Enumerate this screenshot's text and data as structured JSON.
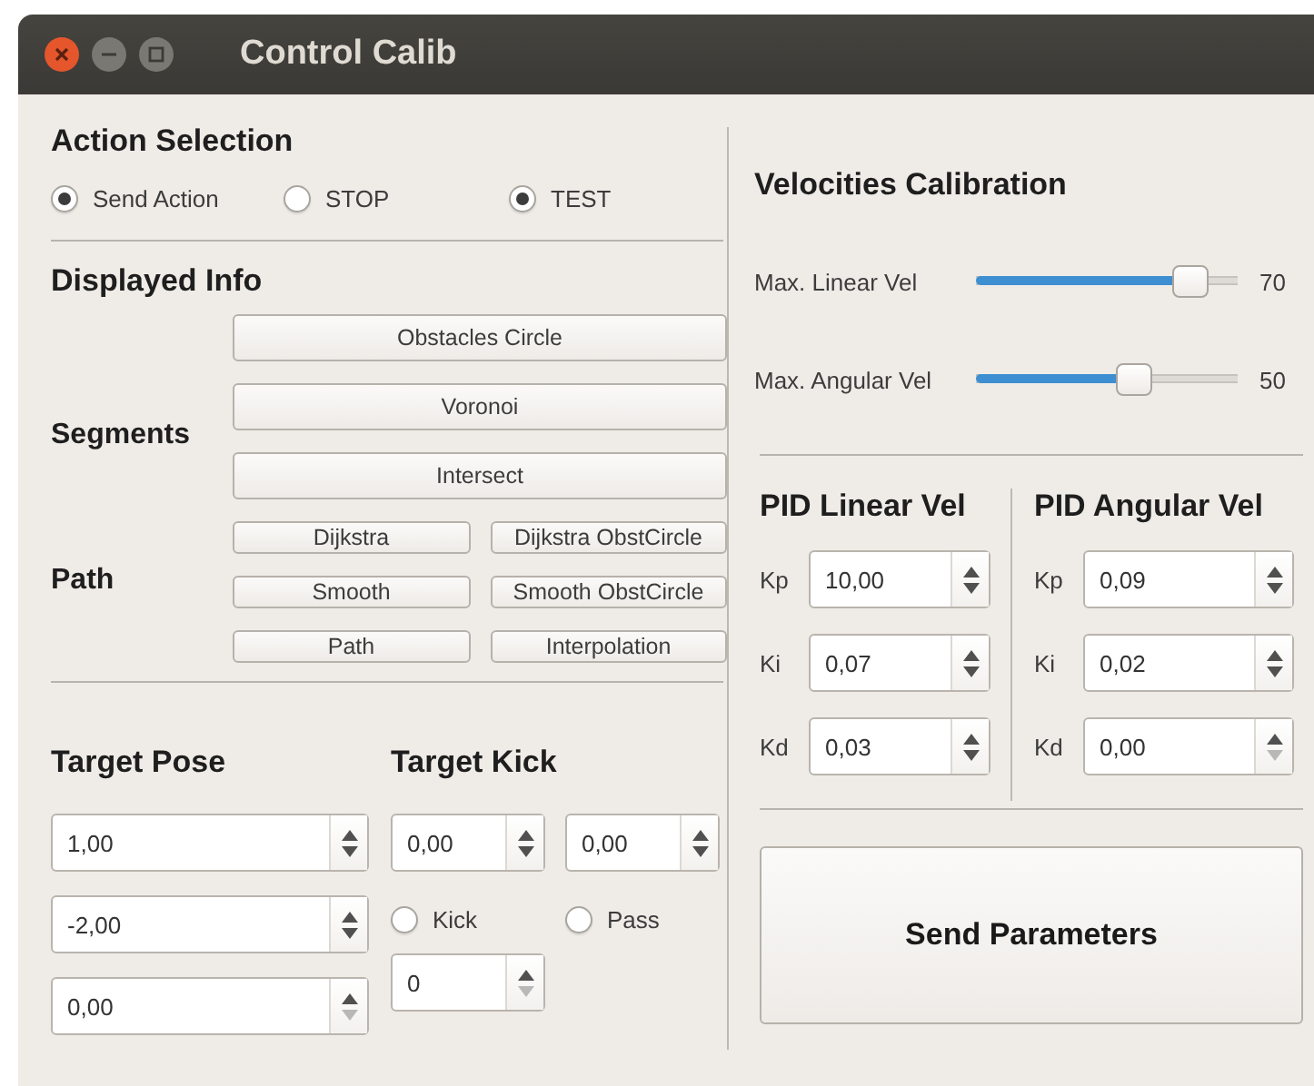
{
  "window": {
    "title": "Control Calib"
  },
  "action_selection": {
    "title": "Action Selection",
    "options": [
      {
        "label": "Send Action",
        "selected": true
      },
      {
        "label": "STOP",
        "selected": false
      },
      {
        "label": "TEST",
        "selected": true
      }
    ]
  },
  "displayed_info": {
    "title": "Displayed Info",
    "groups": [
      {
        "label": "Segments",
        "rows": [
          [
            "Obstacles Circle"
          ],
          [
            "Voronoi"
          ],
          [
            "Intersect"
          ]
        ]
      },
      {
        "label": "Path",
        "rows": [
          [
            "Dijkstra",
            "Dijkstra ObstCircle"
          ],
          [
            "Smooth",
            "Smooth ObstCircle"
          ],
          [
            "Path",
            "Interpolation"
          ]
        ]
      }
    ]
  },
  "target_pose": {
    "title": "Target Pose",
    "fields": [
      {
        "value": "1,00",
        "down_disabled": false
      },
      {
        "value": "-2,00",
        "down_disabled": false
      },
      {
        "value": "0,00",
        "down_disabled": true
      }
    ]
  },
  "target_kick": {
    "title": "Target Kick",
    "fields": [
      {
        "value": "0,00",
        "down_disabled": false
      },
      {
        "value": "0,00",
        "down_disabled": false
      }
    ],
    "options": [
      {
        "label": "Kick",
        "selected": false
      },
      {
        "label": "Pass",
        "selected": false
      }
    ],
    "count": {
      "value": "0",
      "down_disabled": true
    }
  },
  "velocities": {
    "title": "Velocities Calibration",
    "sliders": [
      {
        "label": "Max. Linear Vel",
        "level": 0.87,
        "reading": "70"
      },
      {
        "label": "Max. Angular Vel",
        "level": 0.62,
        "reading": "50"
      }
    ]
  },
  "pid": [
    {
      "title": "PID Linear Vel",
      "gains": [
        {
          "label": "Kp",
          "value": "10,00",
          "down_disabled": false
        },
        {
          "label": "Ki",
          "value": "0,07",
          "down_disabled": false
        },
        {
          "label": "Kd",
          "value": "0,03",
          "down_disabled": false
        }
      ]
    },
    {
      "title": "PID Angular Vel",
      "gains": [
        {
          "label": "Kp",
          "value": "0,09",
          "down_disabled": false
        },
        {
          "label": "Ki",
          "value": "0,02",
          "down_disabled": false
        },
        {
          "label": "Kd",
          "value": "0,00",
          "down_disabled": true
        }
      ]
    }
  ],
  "send_button": {
    "label": "Send Parameters"
  }
}
